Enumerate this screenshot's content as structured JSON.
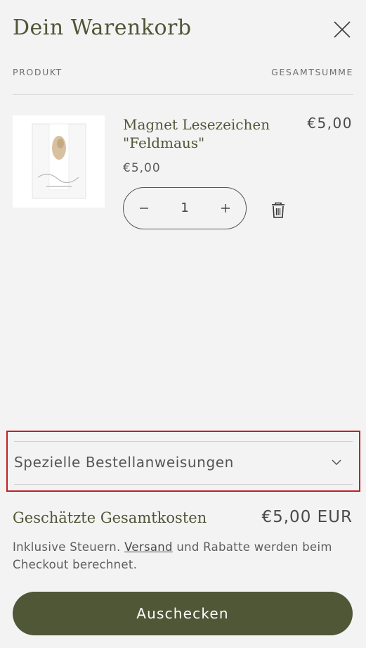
{
  "header": {
    "title": "Dein Warenkorb"
  },
  "table": {
    "col_product": "PRODUKT",
    "col_total": "GESAMTSUMME"
  },
  "item": {
    "name": "Magnet Lesezeichen \"Feldmaus\"",
    "price": "€5,00",
    "total": "€5,00",
    "quantity": "1"
  },
  "instructions": {
    "label": "Spezielle Bestellanweisungen"
  },
  "summary": {
    "estimated_label": "Geschätzte Gesamtkosten",
    "estimated_value": "€5,00 EUR",
    "tax_prefix": "Inklusive Steuern. ",
    "shipping_link": "Versand",
    "tax_suffix": " und Rabatte werden beim Checkout berechnet."
  },
  "checkout": {
    "label": "Auschecken"
  },
  "colors": {
    "accent": "#4f5737",
    "highlight_border": "#c41f25",
    "background": "#f3f3f3"
  }
}
